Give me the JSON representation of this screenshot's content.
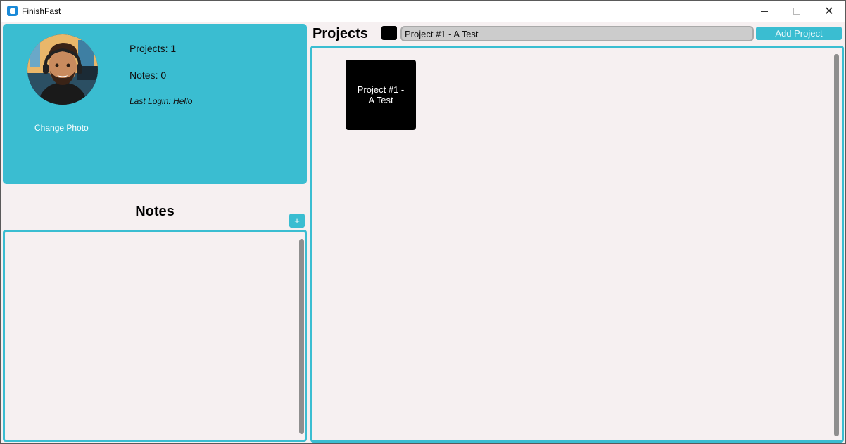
{
  "window": {
    "title": "FinishFast",
    "minimize_glyph": "—",
    "maximize_glyph": "☐",
    "close_glyph": "✕"
  },
  "profile": {
    "change_photo_label": "Change Photo",
    "projects_label": "Projects: 1",
    "notes_label": "Notes: 0",
    "last_login_label": "Last Login: Hello"
  },
  "notes": {
    "title": "Notes",
    "add_button_label": "+"
  },
  "projects": {
    "title": "Projects",
    "input_value": "Project #1 - A Test",
    "add_button_label": "Add Project",
    "selected_color": "#000000",
    "items": [
      {
        "label": "Project #1 - A Test",
        "color": "#000000"
      }
    ]
  },
  "colors": {
    "accent": "#3abdd1",
    "panel_background": "#f6f0f1",
    "scrollbar": "#8e8e8e"
  },
  "icons": {
    "app": "app-icon",
    "avatar": "avatar-image"
  }
}
